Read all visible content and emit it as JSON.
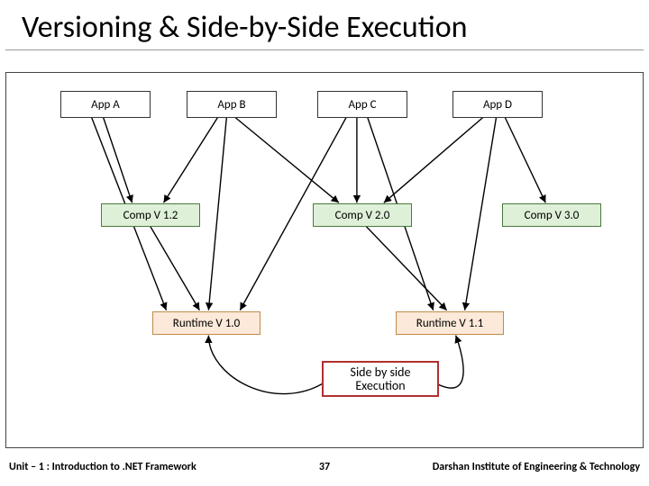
{
  "title": "Versioning & Side-by-Side Execution",
  "apps": [
    "App A",
    "App B",
    "App C",
    "App D"
  ],
  "comps": [
    "Comp V 1.2",
    "Comp V 2.0",
    "Comp V 3.0"
  ],
  "runtimes": [
    "Runtime V 1.0",
    "Runtime V 1.1"
  ],
  "callout": "Side by side\nExecution",
  "footer": {
    "left": "Unit – 1 : Introduction to .NET Framework",
    "slide": "37",
    "right": "Darshan Institute of Engineering & Technology"
  },
  "diagram_arrows": [
    {
      "from": "App A",
      "to": "Comp V 1.2"
    },
    {
      "from": "App A",
      "to": "Runtime V 1.0"
    },
    {
      "from": "App B",
      "to": "Comp V 1.2"
    },
    {
      "from": "App B",
      "to": "Comp V 2.0"
    },
    {
      "from": "App B",
      "to": "Runtime V 1.0"
    },
    {
      "from": "App C",
      "to": "Comp V 2.0"
    },
    {
      "from": "App C",
      "to": "Runtime V 1.0"
    },
    {
      "from": "App C",
      "to": "Runtime V 1.1"
    },
    {
      "from": "App D",
      "to": "Comp V 2.0"
    },
    {
      "from": "App D",
      "to": "Comp V 3.0"
    },
    {
      "from": "App D",
      "to": "Runtime V 1.1"
    },
    {
      "from": "Comp V 1.2",
      "to": "Runtime V 1.0"
    },
    {
      "from": "Comp V 2.0",
      "to": "Runtime V 1.1"
    },
    {
      "from": "Side by side Execution",
      "to": "Runtime V 1.0",
      "curve": true
    },
    {
      "from": "Side by side Execution",
      "to": "Runtime V 1.1",
      "curve": true
    }
  ]
}
